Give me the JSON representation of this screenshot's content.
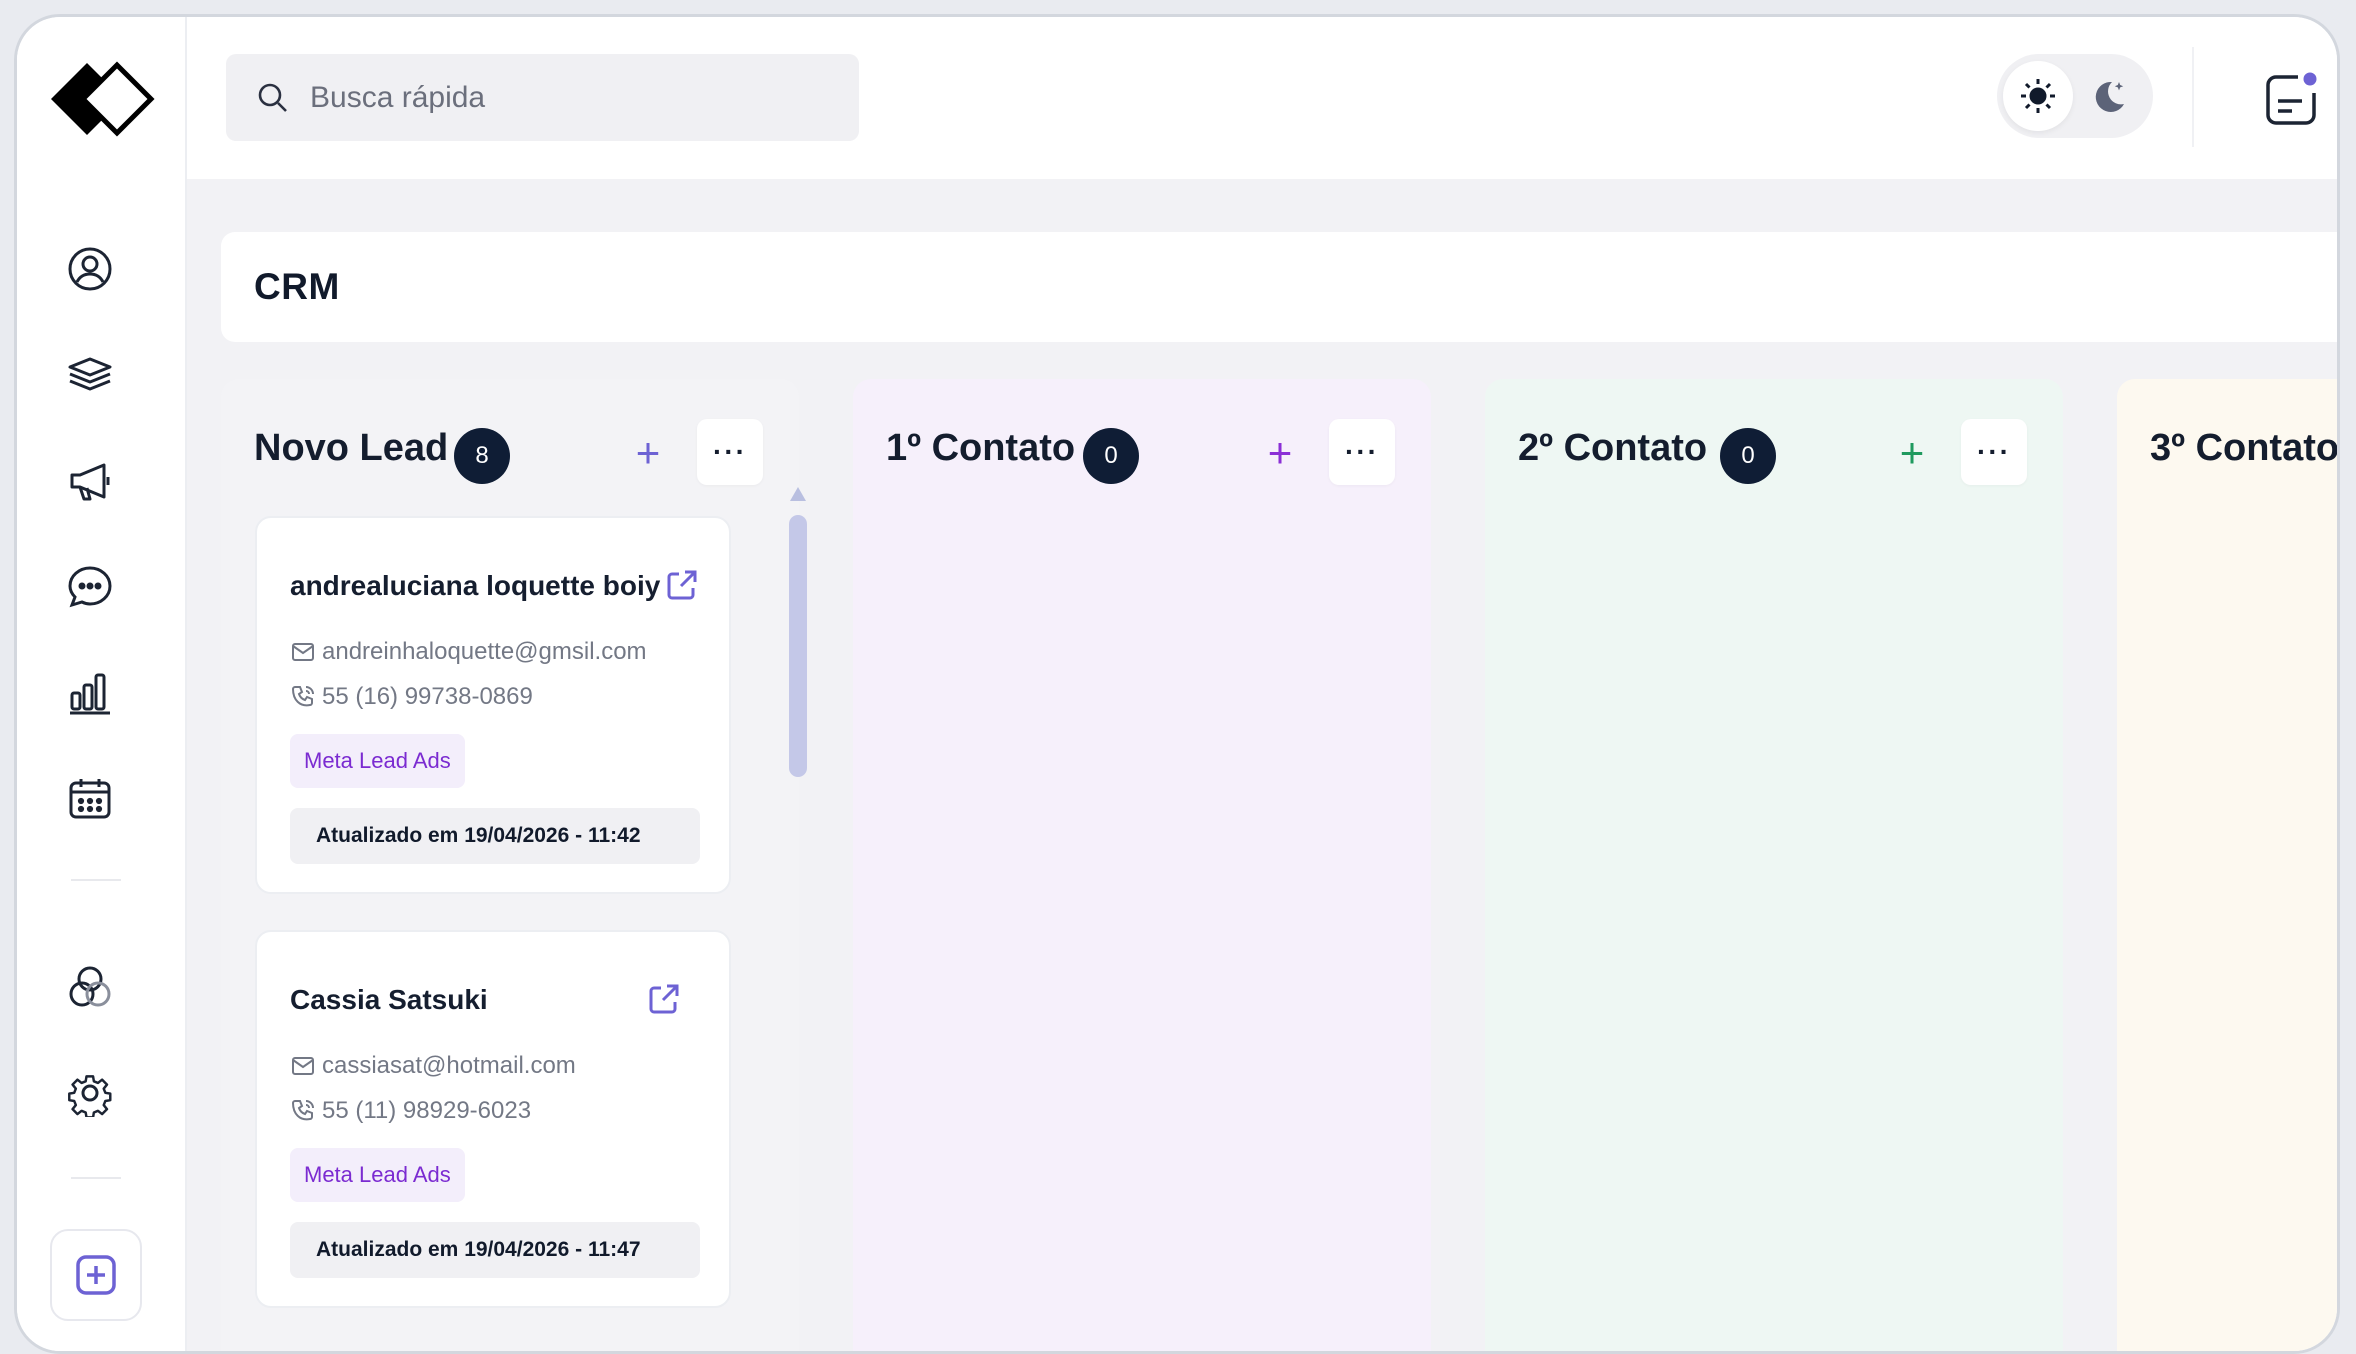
{
  "search": {
    "placeholder": "Busca rápida"
  },
  "page": {
    "title": "CRM"
  },
  "theme": {
    "light_icon": "sun-icon",
    "dark_icon": "moon-icon",
    "active": "light"
  },
  "colors": {
    "accent": "#6d62d4",
    "badge": "#0f1d35",
    "tag_text": "#7b2bd1",
    "col_novo": "#f3f3f6",
    "col_1": "#f6f0fb",
    "col_2": "#eef7f3",
    "col_3": "#fdf9f0"
  },
  "sidebar": {
    "items": [
      {
        "icon": "user-circle-icon"
      },
      {
        "icon": "layers-icon"
      },
      {
        "icon": "megaphone-icon"
      },
      {
        "icon": "chat-bubble-icon"
      },
      {
        "icon": "bar-chart-icon"
      },
      {
        "icon": "calendar-icon"
      },
      {
        "icon": "circles-icon"
      },
      {
        "icon": "gear-icon"
      }
    ],
    "add_icon": "plus-square-icon"
  },
  "columns": [
    {
      "title": "Novo Lead",
      "count": "8",
      "cards": [
        {
          "name": "andrealuciana loquette boiy",
          "email": "andreinhaloquette@gmsil.com",
          "phone": "55 (16) 99738-0869",
          "tag": "Meta Lead Ads",
          "updated": "Atualizado em 19/04/2026 - 11:42"
        },
        {
          "name": "Cassia Satsuki",
          "email": "cassiasat@hotmail.com",
          "phone": "55 (11) 98929-6023",
          "tag": "Meta Lead Ads",
          "updated": "Atualizado em 19/04/2026 - 11:47"
        }
      ]
    },
    {
      "title": "1º Contato",
      "count": "0",
      "cards": []
    },
    {
      "title": "2º Contato",
      "count": "0",
      "cards": []
    },
    {
      "title": "3º Contato",
      "cards": []
    }
  ],
  "menu_label": "···",
  "add_label": "+"
}
